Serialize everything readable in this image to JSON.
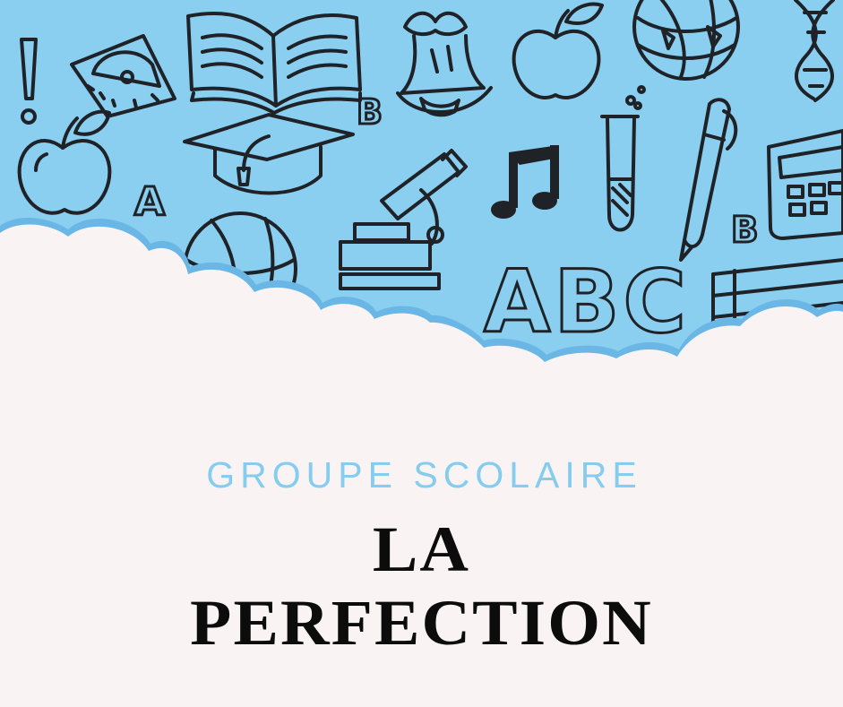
{
  "colors": {
    "sky_background": "#8acef0",
    "cloud": "#f9f4f3",
    "cloud_outline": "#6ab7e6",
    "doodle_ink": "#1f2227",
    "subtitle": "#86ccef",
    "title": "#0c0c0c"
  },
  "header": {
    "doodle_icons": [
      "exclamation-icon",
      "protractor-icon",
      "open-book-icon",
      "bell-icon",
      "apple-icon",
      "globe-icon",
      "dna-icon",
      "graduation-cap-icon",
      "microscope-icon",
      "music-note-icon",
      "test-tube-icon",
      "pen-icon",
      "calculator-icon",
      "books-stack-icon"
    ],
    "letters": {
      "a_small": "A",
      "b_small": "B",
      "b_right": "B",
      "abc": "ABC"
    }
  },
  "school": {
    "subtitle": "GROUPE SCOLAIRE",
    "name_line_1": "LA",
    "name_line_2": "PERFECTION"
  }
}
